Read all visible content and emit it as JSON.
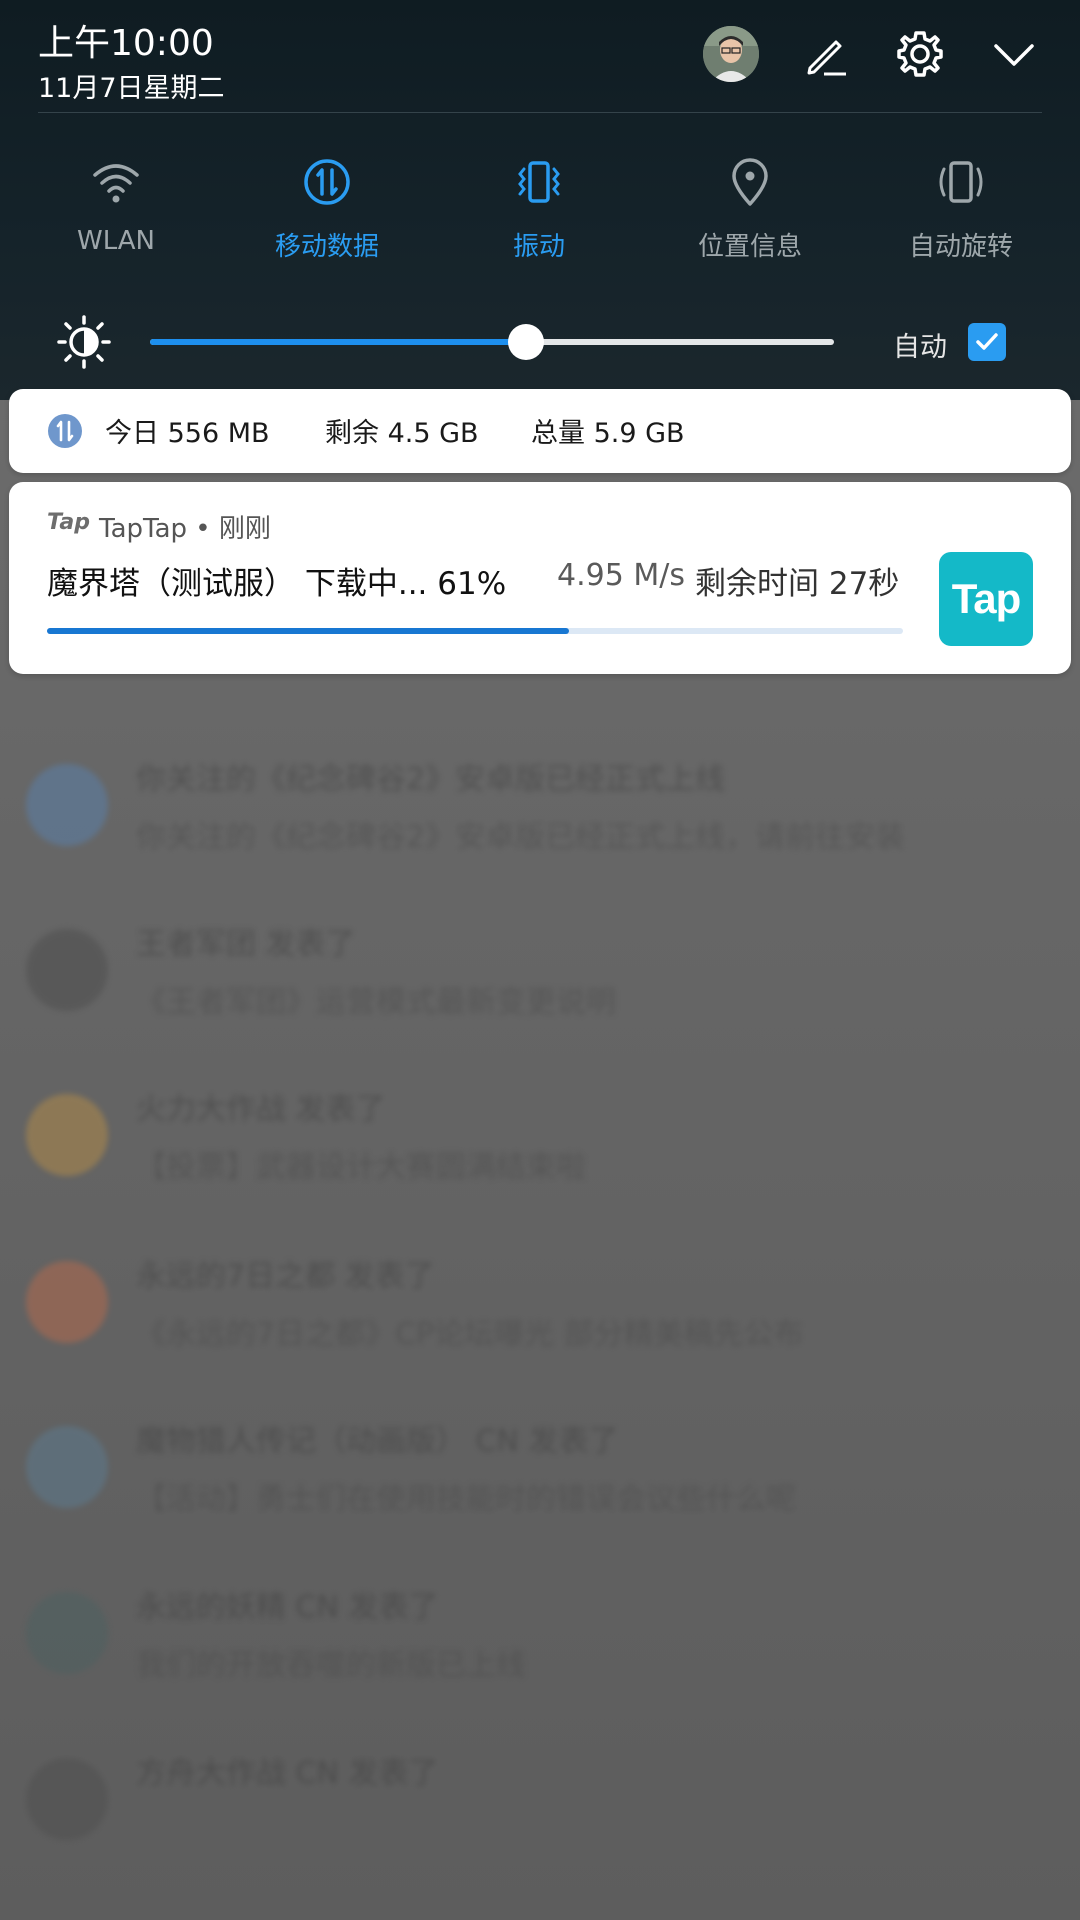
{
  "status": {
    "time": "上午10:00",
    "date": "11月7日星期二"
  },
  "header_icons": {
    "avatar": "user-avatar",
    "edit": "edit-icon",
    "settings": "gear-icon",
    "collapse": "chevron-down-icon"
  },
  "toggles": [
    {
      "label": "WLAN",
      "icon": "wifi-icon",
      "active": false
    },
    {
      "label": "移动数据",
      "icon": "mobile-data-icon",
      "active": true
    },
    {
      "label": "振动",
      "icon": "vibrate-icon",
      "active": true
    },
    {
      "label": "位置信息",
      "icon": "location-icon",
      "active": false
    },
    {
      "label": "自动旋转",
      "icon": "auto-rotate-icon",
      "active": false
    }
  ],
  "brightness": {
    "icon": "brightness-icon",
    "level": 0.55,
    "auto_label": "自动",
    "auto_checked": true
  },
  "data_usage": {
    "icon": "mobile-data-icon",
    "today": "今日 556 MB",
    "remaining": "剩余 4.5 GB",
    "total": "总量 5.9 GB"
  },
  "download": {
    "app_logo_text": "Tap",
    "app_line": "TapTap • 刚刚",
    "title": "魔界塔（测试服） 下载中... 61%",
    "speed": "4.95 M/s",
    "remaining": "剩余时间 27秒",
    "progress": 0.61,
    "icon_text": "Tap"
  },
  "feed": [
    {
      "title": "你关注的《纪念碑谷2》安卓版已经正式上线",
      "body": "你关注的《纪念碑谷2》安卓版已经正式上线，请前往安装",
      "avatar_color": "#5b7fa8"
    },
    {
      "title": "王者军团 发表了",
      "body": "《王者军团》运营模式最新变更说明",
      "avatar_color": "#4f4f4f"
    },
    {
      "title": "火力大作战 发表了",
      "body": "【投票】武器设计大赛圆满结束啦",
      "avatar_color": "#b08a4a"
    },
    {
      "title": "永远的7日之都 发表了",
      "body": "《永远的7日之都》CP论坛曝光 部分精美稿先公布",
      "avatar_color": "#b26a4e"
    },
    {
      "title": "魔物猎人传记（动画版） CN 发表了",
      "body": "【活动】勇士们在使用技能时的错误会议些什么呢",
      "avatar_color": "#5d7a8e"
    },
    {
      "title": "永远的妖精 CN 发表了",
      "body": "我们的开放吞噬的新版已上线",
      "avatar_color": "#4d6060"
    },
    {
      "title": "方舟大作战 CN 发表了",
      "body": "",
      "avatar_color": "#505050"
    }
  ]
}
